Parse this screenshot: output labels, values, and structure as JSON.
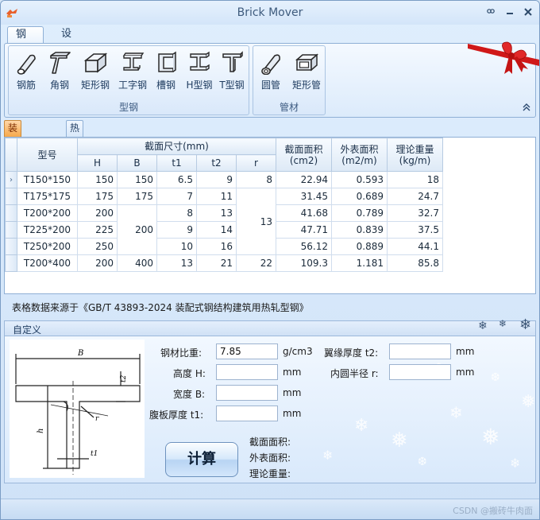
{
  "window": {
    "title": "Brick Mover"
  },
  "ribbon": {
    "tabs": [
      {
        "label": "钢材"
      },
      {
        "label": "设置"
      }
    ],
    "groups": [
      {
        "label": "型钢",
        "buttons": [
          {
            "label": "钢筋",
            "icon": "round-bar-icon"
          },
          {
            "label": "角钢",
            "icon": "angle-steel-icon"
          },
          {
            "label": "矩形钢",
            "icon": "rect-steel-icon"
          },
          {
            "label": "工字钢",
            "icon": "i-beam-icon"
          },
          {
            "label": "槽钢",
            "icon": "channel-steel-icon"
          },
          {
            "label": "H型钢",
            "icon": "h-beam-icon"
          },
          {
            "label": "T型钢",
            "icon": "t-beam-icon"
          }
        ]
      },
      {
        "label": "管材",
        "buttons": [
          {
            "label": "圆管",
            "icon": "round-tube-icon"
          },
          {
            "label": "矩形管",
            "icon": "rect-tube-icon"
          }
        ]
      }
    ]
  },
  "doc_tabs": [
    {
      "label": "装配式T型钢"
    },
    {
      "label": "热轧T型钢"
    }
  ],
  "grid": {
    "headers": {
      "model": "型号",
      "section": "截面尺寸(mm)",
      "H": "H",
      "B": "B",
      "t1": "t1",
      "t2": "t2",
      "r": "r",
      "area": "截面面积\n(cm2)",
      "surface": "外表面积\n(m2/m)",
      "weight": "理论重量\n(kg/m)"
    },
    "rows": [
      {
        "model": "T150*150",
        "H": "150",
        "B": "150",
        "t1": "6.5",
        "t2": "9",
        "r": "8",
        "area": "22.94",
        "surface": "0.593",
        "weight": "18"
      },
      {
        "model": "T175*175",
        "H": "175",
        "B": "175",
        "t1": "7",
        "t2": "11",
        "r": "",
        "area": "31.45",
        "surface": "0.689",
        "weight": "24.7"
      },
      {
        "model": "T200*200",
        "H": "200",
        "B": "",
        "t1": "8",
        "t2": "13",
        "r": "13",
        "area": "41.68",
        "surface": "0.789",
        "weight": "32.7"
      },
      {
        "model": "T225*200",
        "H": "225",
        "B": "200",
        "t1": "9",
        "t2": "14",
        "r": "",
        "area": "47.71",
        "surface": "0.839",
        "weight": "37.5"
      },
      {
        "model": "T250*200",
        "H": "250",
        "B": "",
        "t1": "10",
        "t2": "16",
        "r": "",
        "area": "56.12",
        "surface": "0.889",
        "weight": "44.1"
      },
      {
        "model": "T200*400",
        "H": "200",
        "B": "400",
        "t1": "13",
        "t2": "21",
        "r": "22",
        "area": "109.3",
        "surface": "1.181",
        "weight": "85.8"
      }
    ]
  },
  "source_note": "表格数据来源于《GB/T 43893-2024 装配式钢结构建筑用热轧型钢》",
  "custom": {
    "header": "自定义",
    "density_label": "钢材比重:",
    "density_value": "7.85",
    "density_unit": "g/cm3",
    "height_label": "高度 H:",
    "height_unit": "mm",
    "width_label": "宽度 B:",
    "width_unit": "mm",
    "web_label": "腹板厚度 t1:",
    "web_unit": "mm",
    "flange_label": "翼缘厚度 t2:",
    "flange_unit": "mm",
    "radius_label": "内圆半径 r:",
    "radius_unit": "mm",
    "calc_button": "计算",
    "result_area": "截面面积:",
    "result_surface": "外表面积:",
    "result_weight": "理论重量:",
    "diagram": {
      "B": "B",
      "t2": "t2",
      "r": "r",
      "h": "h",
      "t1": "t1"
    }
  },
  "status": {
    "watermark": "CSDN @搬砖牛肉面"
  }
}
